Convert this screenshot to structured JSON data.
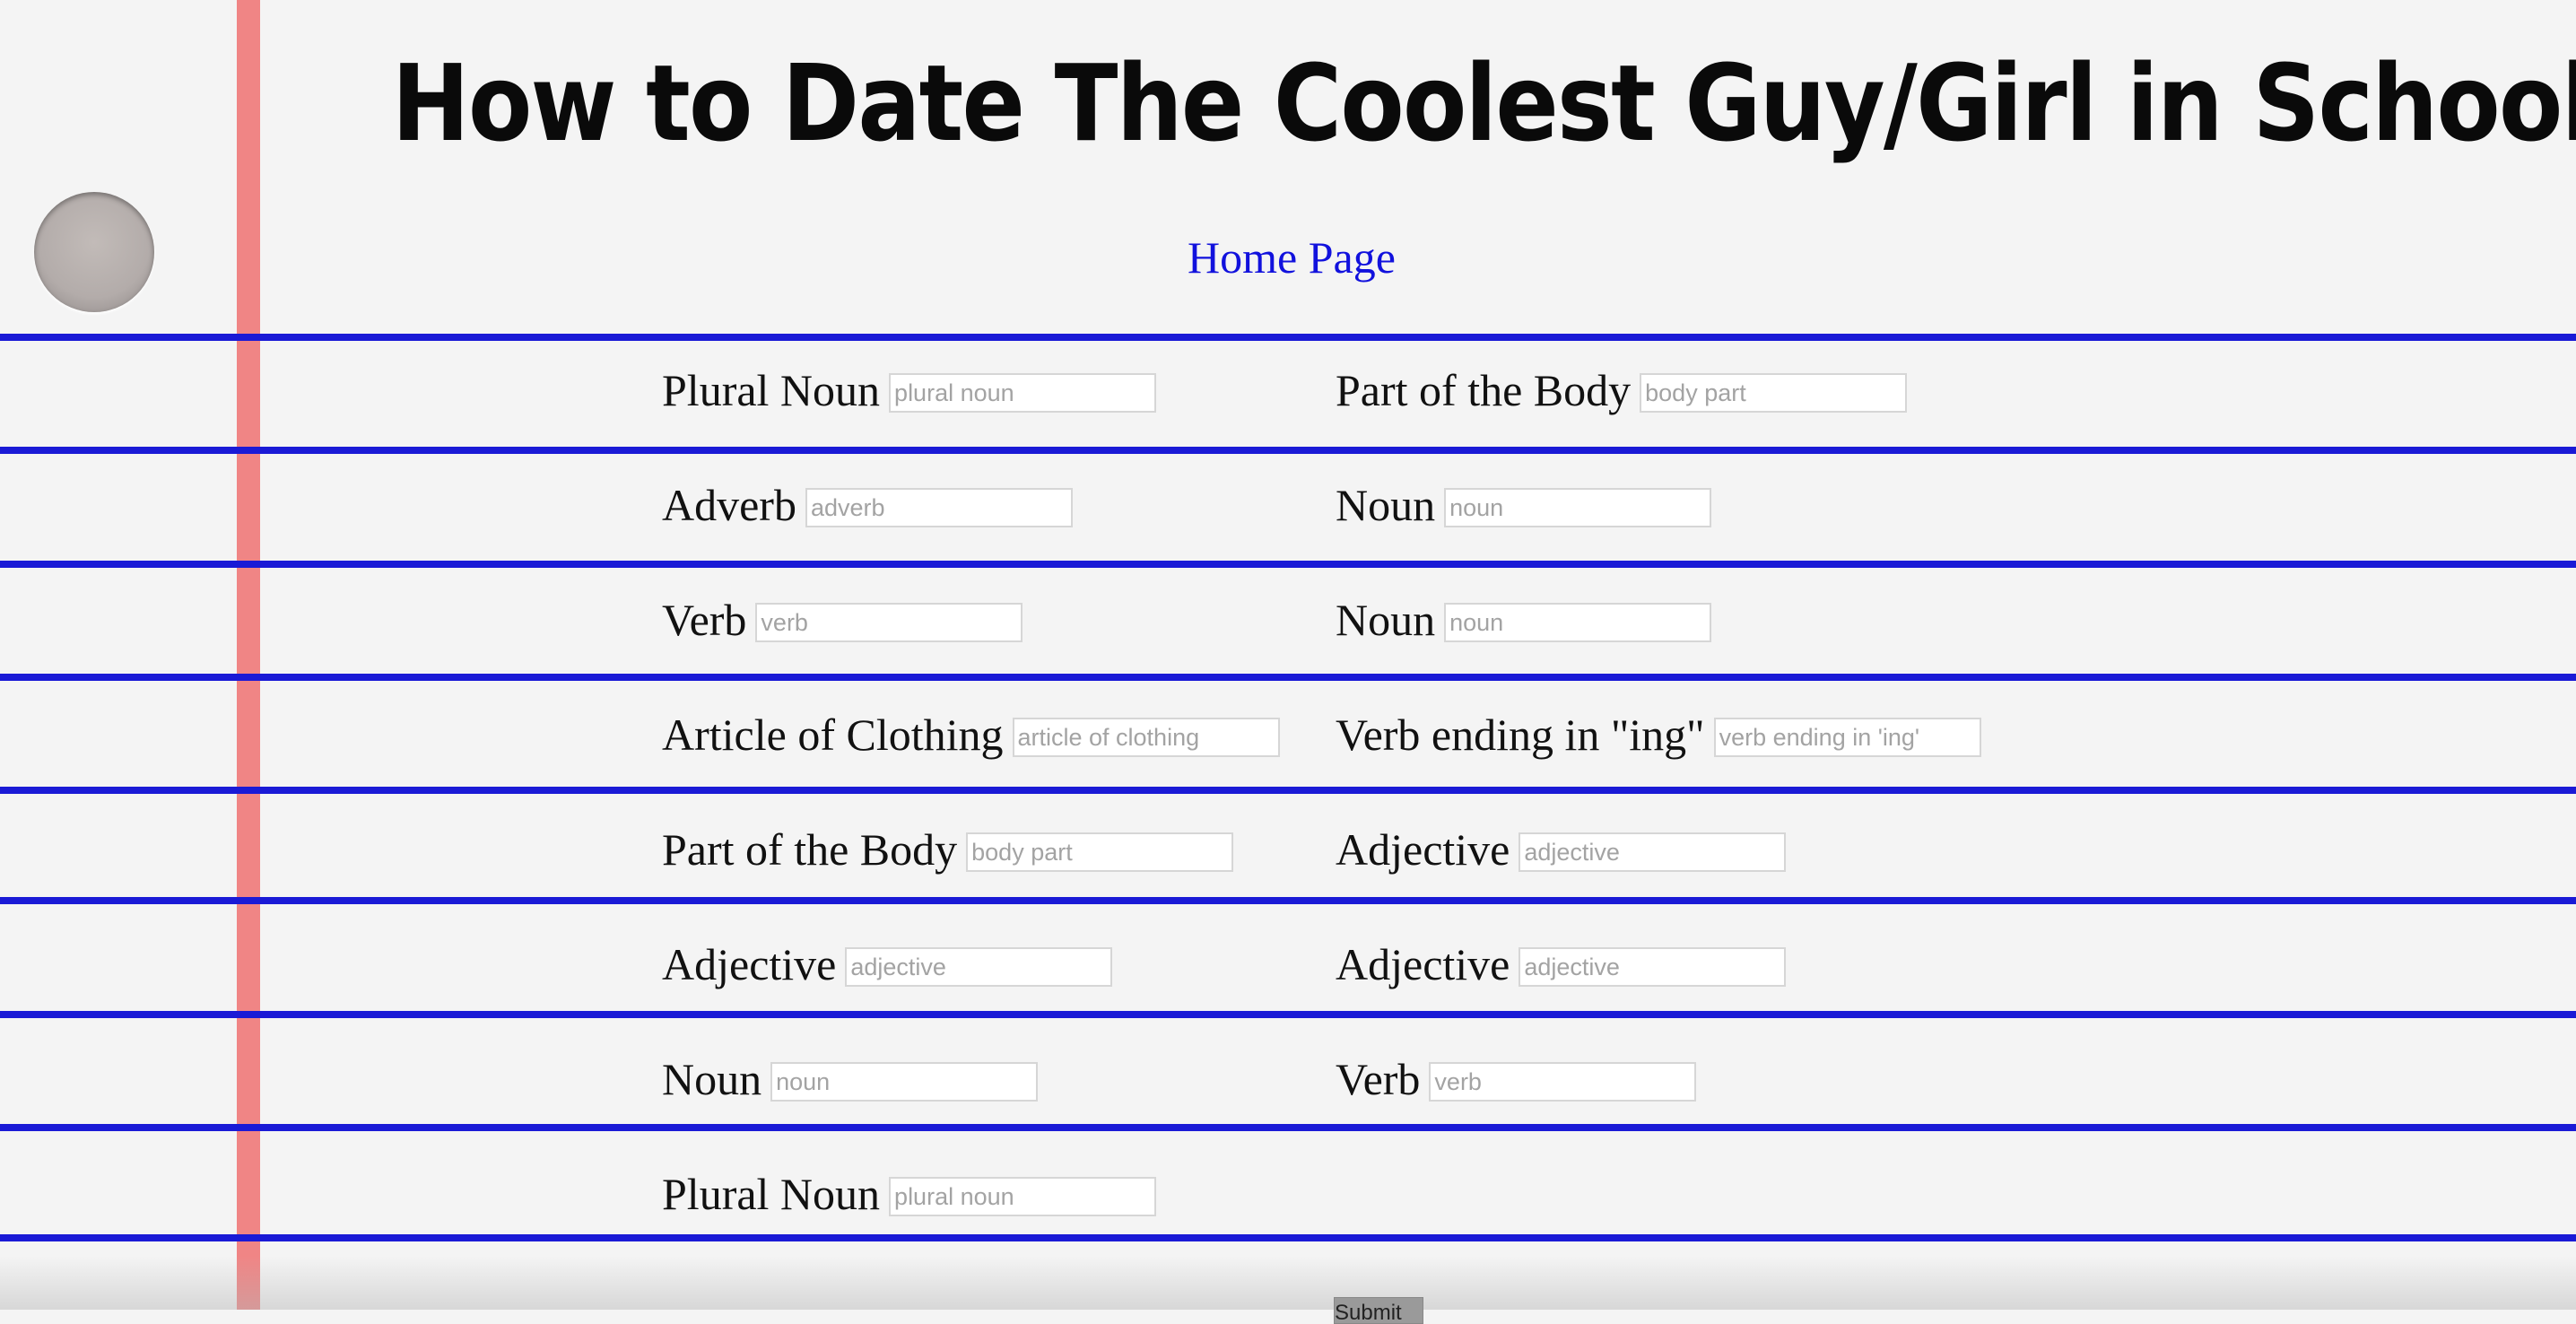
{
  "header": {
    "title": "How to Date The Coolest Guy/Girl in School",
    "home_link": "Home Page"
  },
  "form": {
    "fields": [
      {
        "label": "Plural Noun",
        "placeholder": "plural noun",
        "value": ""
      },
      {
        "label": "Part of the Body",
        "placeholder": "body part",
        "value": ""
      },
      {
        "label": "Adverb",
        "placeholder": "adverb",
        "value": ""
      },
      {
        "label": "Noun",
        "placeholder": "noun",
        "value": ""
      },
      {
        "label": "Verb",
        "placeholder": "verb",
        "value": ""
      },
      {
        "label": "Noun",
        "placeholder": "noun",
        "value": ""
      },
      {
        "label": "Article of Clothing",
        "placeholder": "article of clothing",
        "value": ""
      },
      {
        "label": "Verb ending in \"ing\"",
        "placeholder": "verb ending in 'ing'",
        "value": ""
      },
      {
        "label": "Part of the Body",
        "placeholder": "body part",
        "value": ""
      },
      {
        "label": "Adjective",
        "placeholder": "adjective",
        "value": ""
      },
      {
        "label": "Adjective",
        "placeholder": "adjective",
        "value": ""
      },
      {
        "label": "Adjective",
        "placeholder": "adjective",
        "value": ""
      },
      {
        "label": "Noun",
        "placeholder": "noun",
        "value": ""
      },
      {
        "label": "Verb",
        "placeholder": "verb",
        "value": ""
      },
      {
        "label": "Plural Noun",
        "placeholder": "plural noun",
        "value": ""
      }
    ],
    "submit_label": "Submit"
  },
  "colors": {
    "rule_line": "#1a1ad6",
    "margin_line": "#f08585",
    "link": "#1111dd",
    "paper": "#f4f4f4"
  }
}
